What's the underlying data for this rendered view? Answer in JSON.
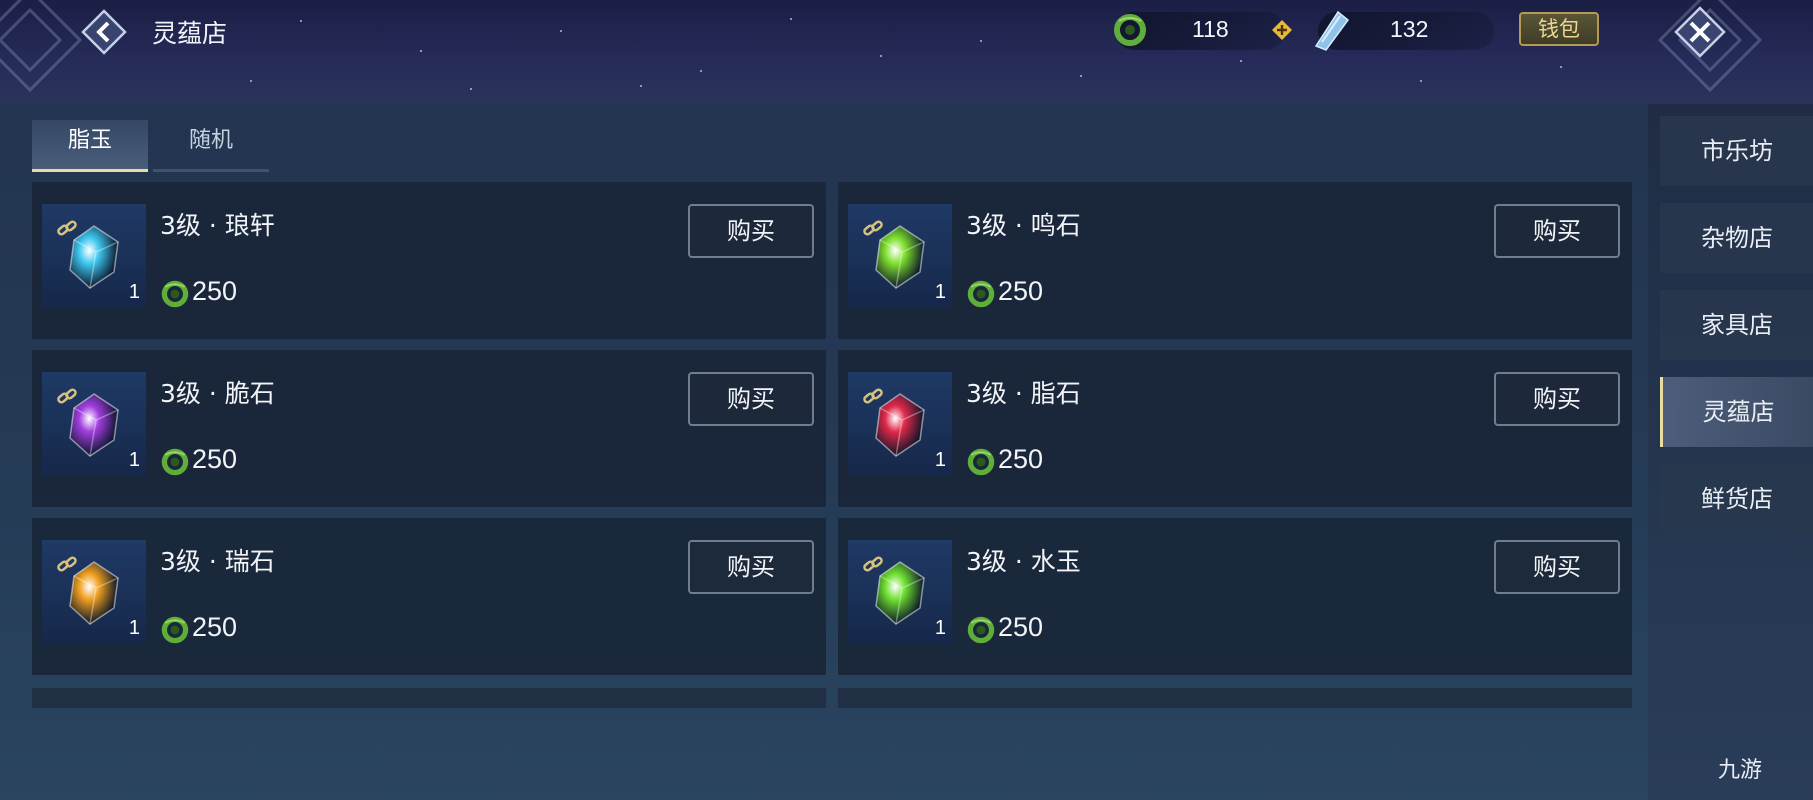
{
  "header": {
    "title": "灵蕴店",
    "currency_1": {
      "icon": "jade-coin-icon",
      "value": "118"
    },
    "currency_2": {
      "icon": "spirit-crystal-icon",
      "value": "132"
    },
    "wallet_label": "钱包"
  },
  "tabs": [
    {
      "label": "脂玉",
      "active": true
    },
    {
      "label": "随机",
      "active": false
    }
  ],
  "items": [
    {
      "name": "3级 · 琅轩",
      "qty": "1",
      "price": "250",
      "buy_label": "购买",
      "color": "#3fc8f0"
    },
    {
      "name": "3级 · 鸣石",
      "qty": "1",
      "price": "250",
      "buy_label": "购买",
      "color": "#7fe02e"
    },
    {
      "name": "3级 · 脆石",
      "qty": "1",
      "price": "250",
      "buy_label": "购买",
      "color": "#a23ee0"
    },
    {
      "name": "3级 · 脂石",
      "qty": "1",
      "price": "250",
      "buy_label": "购买",
      "color": "#e02a4a"
    },
    {
      "name": "3级 · 瑞石",
      "qty": "1",
      "price": "250",
      "buy_label": "购买",
      "color": "#f0a020"
    },
    {
      "name": "3级 · 水玉",
      "qty": "1",
      "price": "250",
      "buy_label": "购买",
      "color": "#6ee030"
    }
  ],
  "sidebar": {
    "items": [
      {
        "label": "市乐坊",
        "active": false
      },
      {
        "label": "杂物店",
        "active": false
      },
      {
        "label": "家具店",
        "active": false
      },
      {
        "label": "灵蕴店",
        "active": true
      },
      {
        "label": "鲜货店",
        "active": false
      }
    ]
  },
  "watermark": "九游"
}
